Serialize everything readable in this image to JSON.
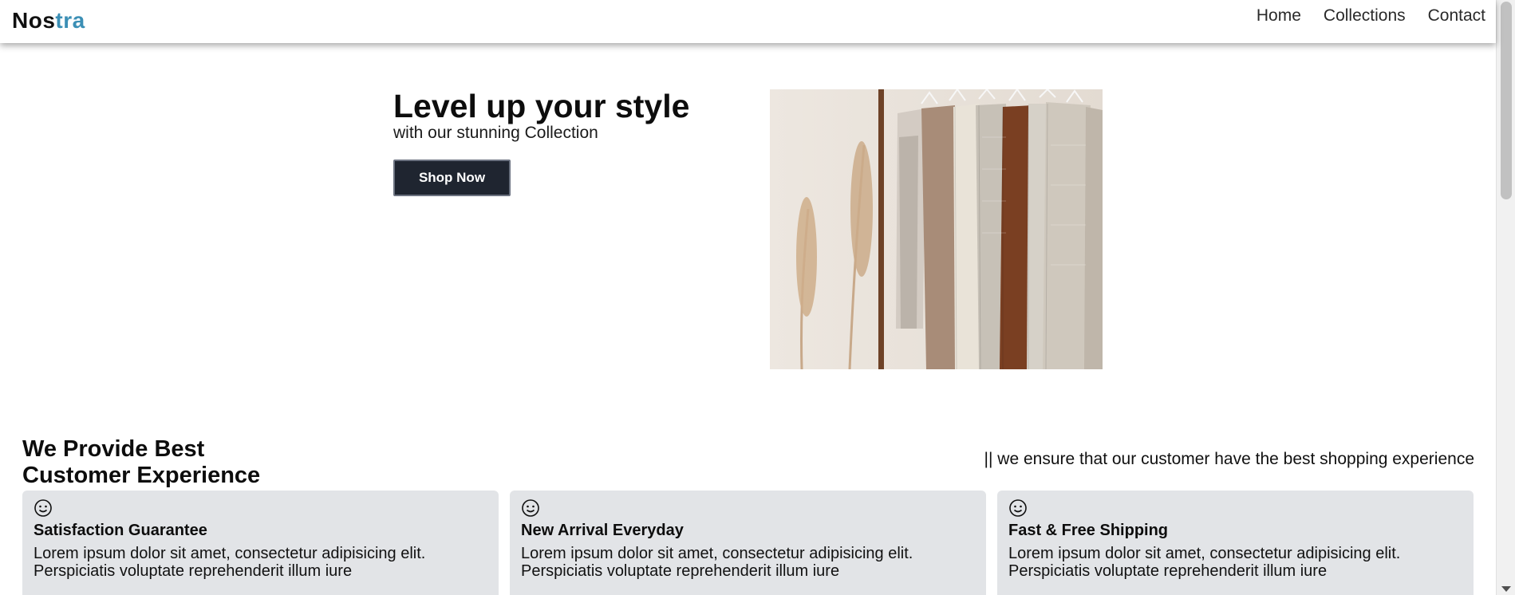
{
  "brand": {
    "name_part1": "Nos",
    "name_part2": "tra",
    "accent_color": "#3b8fb5"
  },
  "nav": {
    "items": [
      "Home",
      "Collections",
      "Contact"
    ]
  },
  "hero": {
    "title": "Level up your style",
    "subtitle": "with our stunning Collection",
    "cta_label": "Shop Now",
    "button_color": "#1f2530"
  },
  "features": {
    "title_line1": "We Provide Best",
    "title_line2": "Customer Experience",
    "tagline": "|| we ensure that our customer have the best shopping experience",
    "card_bg": "#e2e4e7",
    "cards": [
      {
        "icon": "smiley-icon",
        "title": "Satisfaction Guarantee",
        "text_line1": "Lorem ipsum dolor sit amet, consectetur adipisicing elit.",
        "text_line2": "Perspiciatis voluptate reprehenderit illum iure"
      },
      {
        "icon": "smiley-icon",
        "title": "New Arrival Everyday",
        "text_line1": "Lorem ipsum dolor sit amet, consectetur adipisicing elit.",
        "text_line2": "Perspiciatis voluptate reprehenderit illum iure"
      },
      {
        "icon": "smiley-icon",
        "title": "Fast & Free Shipping",
        "text_line1": "Lorem ipsum dolor sit amet, consectetur adipisicing elit.",
        "text_line2": "Perspiciatis voluptate reprehenderit illum iure"
      }
    ]
  }
}
